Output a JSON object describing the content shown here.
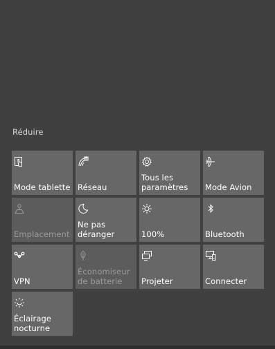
{
  "collapse_label": "Réduire",
  "tiles": [
    {
      "label": "Mode tablette",
      "icon": "tablet-mode-icon",
      "enabled": true
    },
    {
      "label": "Réseau",
      "icon": "network-icon",
      "enabled": true
    },
    {
      "label": "Tous les\nparamètres",
      "icon": "gear-icon",
      "enabled": true
    },
    {
      "label": "Mode Avion",
      "icon": "airplane-icon",
      "enabled": true
    },
    {
      "label": "Emplacement",
      "icon": "location-icon",
      "enabled": false
    },
    {
      "label": "Ne pas\ndéranger",
      "icon": "moon-icon",
      "enabled": true
    },
    {
      "label": "100%",
      "icon": "brightness-icon",
      "enabled": true
    },
    {
      "label": "Bluetooth",
      "icon": "bluetooth-icon",
      "enabled": true
    },
    {
      "label": "VPN",
      "icon": "vpn-icon",
      "enabled": true
    },
    {
      "label": "Économiseur\nde batterie",
      "icon": "battery-saver-icon",
      "enabled": false
    },
    {
      "label": "Projeter",
      "icon": "project-icon",
      "enabled": true
    },
    {
      "label": "Connecter",
      "icon": "connect-icon",
      "enabled": true
    },
    {
      "label": "Éclairage\nnocturne",
      "icon": "night-light-icon",
      "enabled": true
    }
  ]
}
